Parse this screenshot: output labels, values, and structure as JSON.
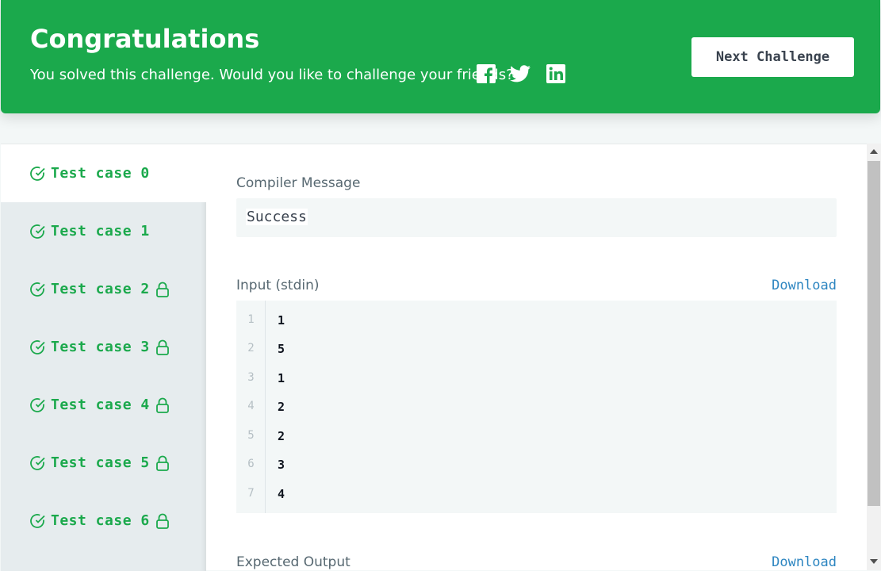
{
  "banner": {
    "title": "Congratulations",
    "subtitle": "You solved this challenge. Would you like to challenge your friends?",
    "social": [
      "facebook-icon",
      "twitter-icon",
      "linkedin-icon"
    ],
    "next_label": "Next Challenge",
    "color": "#1ba94c"
  },
  "tabs": [
    {
      "label": "Test case 0",
      "locked": false,
      "active": true
    },
    {
      "label": "Test case 1",
      "locked": false,
      "active": false
    },
    {
      "label": "Test case 2",
      "locked": true,
      "active": false
    },
    {
      "label": "Test case 3",
      "locked": true,
      "active": false
    },
    {
      "label": "Test case 4",
      "locked": true,
      "active": false
    },
    {
      "label": "Test case 5",
      "locked": true,
      "active": false
    },
    {
      "label": "Test case 6",
      "locked": true,
      "active": false
    }
  ],
  "compiler": {
    "label": "Compiler Message",
    "message": "Success"
  },
  "input": {
    "label": "Input (stdin)",
    "download": "Download",
    "lines": [
      "1",
      "5",
      "1",
      "2",
      "2",
      "3",
      "4"
    ]
  },
  "expected": {
    "label": "Expected Output",
    "download": "Download"
  },
  "colors": {
    "success": "#1ba94c",
    "link": "#2e86c1",
    "code_bg": "#f3f7f7"
  }
}
